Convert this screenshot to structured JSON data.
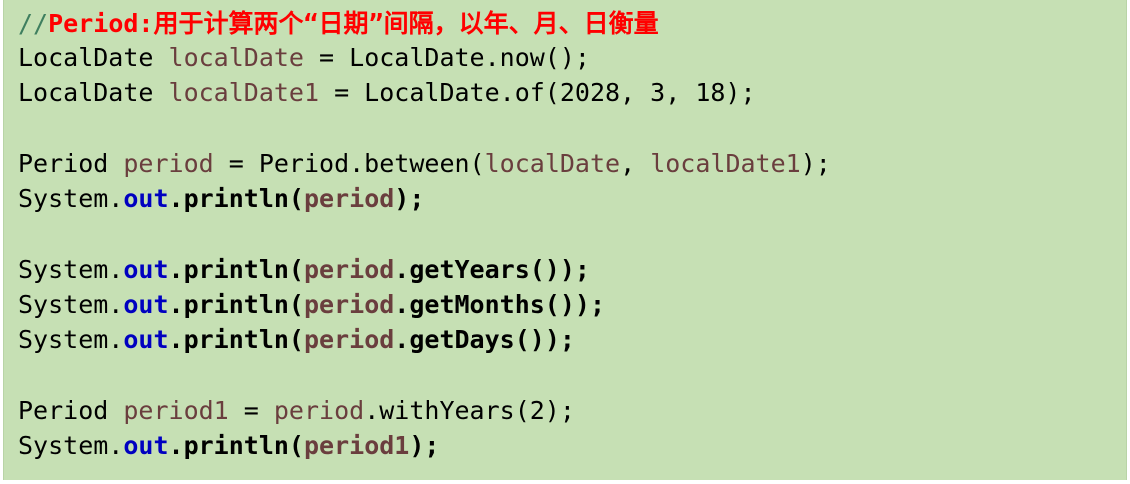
{
  "code": {
    "comment": {
      "slashes": "//",
      "text": "Period:用于计算两个“日期”间隔，以年、月、日衡量"
    },
    "line1": {
      "type": "LocalDate ",
      "var": "localDate",
      "rest": " = LocalDate.now();"
    },
    "line2": {
      "type": "LocalDate ",
      "var": "localDate1",
      "rest": " = LocalDate.of(2028, 3, 18);"
    },
    "line3": {
      "type": "Period ",
      "var": "period",
      "mid": " = Period.between(",
      "arg1": "localDate",
      "sep": ", ",
      "arg2": "localDate1",
      "end": ");"
    },
    "print": {
      "system": "System.",
      "out": "out",
      "println_open": ".println(",
      "close": ");"
    },
    "line4": {
      "arg": "period"
    },
    "line5": {
      "arg": "period",
      "call": ".getYears()",
      "close": ");"
    },
    "line6": {
      "arg": "period",
      "call": ".getMonths()",
      "close": ");"
    },
    "line7": {
      "arg": "period",
      "call": ".getDays()",
      "close": ");"
    },
    "line8": {
      "type": "Period ",
      "var": "period1",
      "mid": " = ",
      "target": "period",
      "rest": ".withYears(2);"
    },
    "line9": {
      "arg": "period1"
    }
  }
}
